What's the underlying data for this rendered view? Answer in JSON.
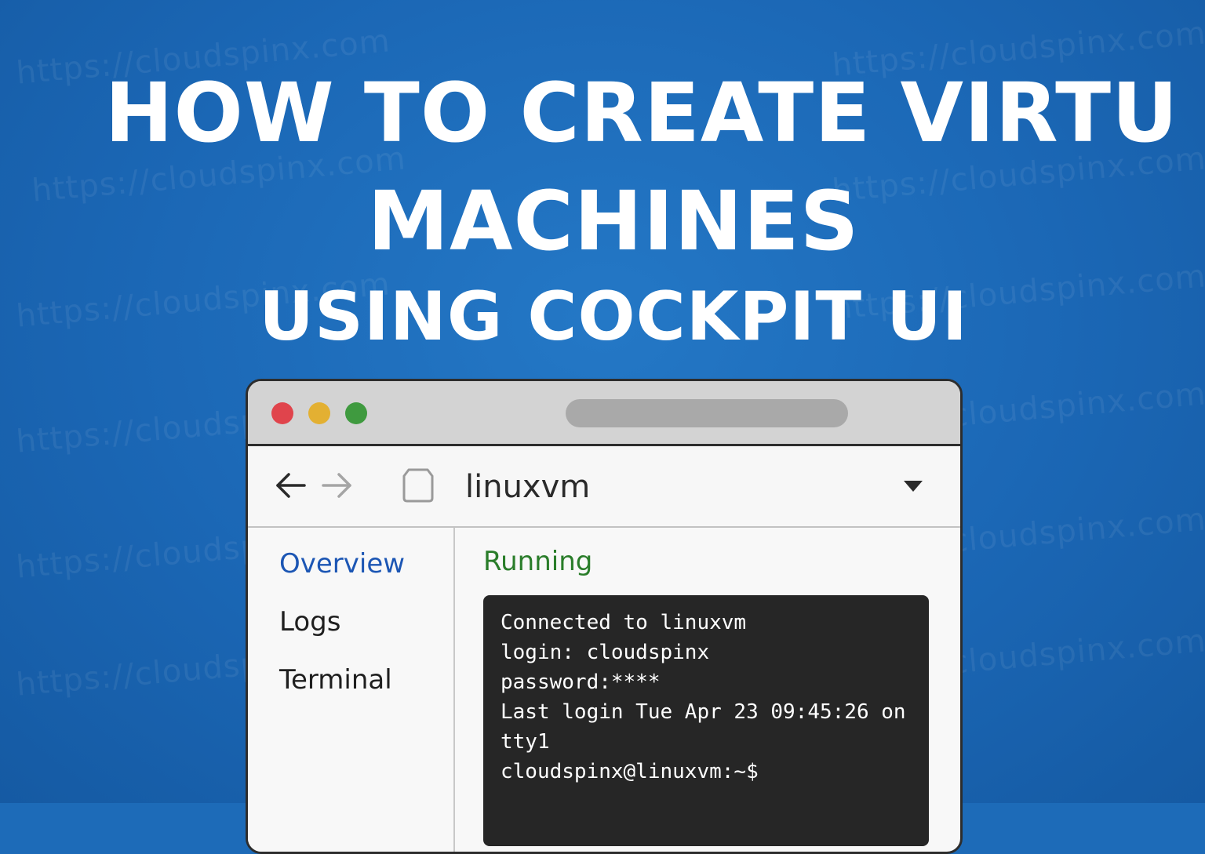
{
  "colors": {
    "background": "#1d6bb8",
    "headline": "#ffffff",
    "active_nav": "#1c56b4",
    "running": "#2a7d2a",
    "terminal_bg": "#262626"
  },
  "watermark": "https://cloudspinx.com",
  "headline": {
    "line1": "HOW TO CREATE VIRTU",
    "line2": "MACHINES",
    "line3": "USING COCKPIT UI"
  },
  "browser": {
    "window_controls": [
      "close",
      "minimize",
      "maximize"
    ],
    "back_icon": "arrow-left-icon",
    "forward_icon": "arrow-right-icon",
    "vm_icon": "vm-icon",
    "vm_name": "linuxvm",
    "dropdown_icon": "caret-down-icon"
  },
  "sidebar": {
    "items": [
      {
        "label": "Overview",
        "active": true
      },
      {
        "label": "Logs",
        "active": false
      },
      {
        "label": "Terminal",
        "active": false
      }
    ]
  },
  "main": {
    "status": "Running",
    "terminal_lines": [
      "Connected to linuxvm",
      "login: cloudspinx",
      "password:****",
      "Last login Tue Apr 23 09:45:26 on",
      "tty1",
      "cloudspinx@linuxvm:~$"
    ]
  }
}
